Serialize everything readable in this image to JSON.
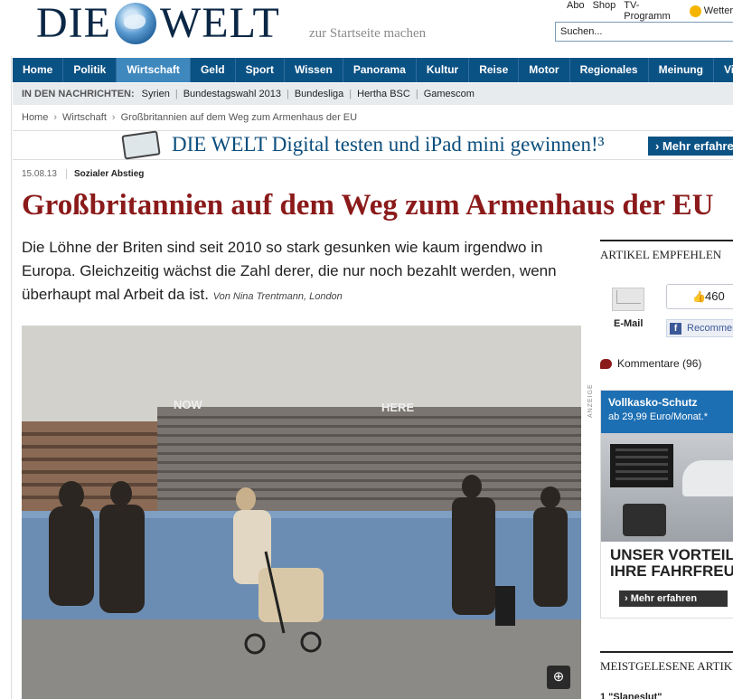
{
  "brand": {
    "logo_left": "DIE",
    "logo_right": "WELT",
    "tagline": "zur Startseite machen"
  },
  "toplinks": [
    "Abo",
    "Shop",
    "TV-Programm",
    "Wetter"
  ],
  "search": {
    "value": "Suchen..."
  },
  "nav": [
    "Home",
    "Politik",
    "Wirtschaft",
    "Geld",
    "Sport",
    "Wissen",
    "Panorama",
    "Kultur",
    "Reise",
    "Motor",
    "Regionales",
    "Meinung",
    "Vi"
  ],
  "nav_active": "Wirtschaft",
  "news": {
    "label": "IN DEN NACHRICHTEN:",
    "items": [
      "Syrien",
      "Bundestagswahl 2013",
      "Bundesliga",
      "Hertha BSC",
      "Gamescom"
    ]
  },
  "breadcrumb": [
    "Home",
    "Wirtschaft",
    "Großbritannien auf dem Weg zum Armenhaus der EU"
  ],
  "banner": {
    "text": "DIE WELT Digital testen und iPad mini gewinnen!³",
    "button": "› Mehr erfahren"
  },
  "article": {
    "date": "15.08.13",
    "kicker": "Sozialer Abstieg",
    "headline": "Großbritannien auf dem Weg zum Armenhaus der EU",
    "lead": "Die Löhne der Briten sind seit 2010 so stark gesunken wie kaum irgendwo in Europa. Gleichzeitig wächst die Zahl derer, die nur noch bezahlt werden, wenn überhaupt mal Arbeit da ist.",
    "author": "Von Nina Trentmann, London",
    "photo_signs": [
      "NOW",
      "HERE"
    ]
  },
  "sidebar": {
    "recommend_title": "ARTIKEL EMPFEHLEN",
    "email_label": "E-Mail",
    "likes": "460",
    "fb_button": "Recommend",
    "comments": "Kommentare (96)",
    "ad_label": "ANZEIGE",
    "ad_title": "Vollkasko-Schutz",
    "ad_price": "ab 29,99 Euro/Monat.*",
    "ad_line1": "UNSER VORTEIL",
    "ad_line2": "IHRE FAHRFREU",
    "ad_button": "› Mehr erfahren",
    "most_read_title": "MEISTGELESENE ARTIKEL",
    "most_read_first": "1   \"Slaneslut\""
  },
  "colors": {
    "nav": "#0b5284",
    "nav_active": "#3f88be",
    "headline": "#8b1a1a",
    "logo": "#0b2745"
  }
}
